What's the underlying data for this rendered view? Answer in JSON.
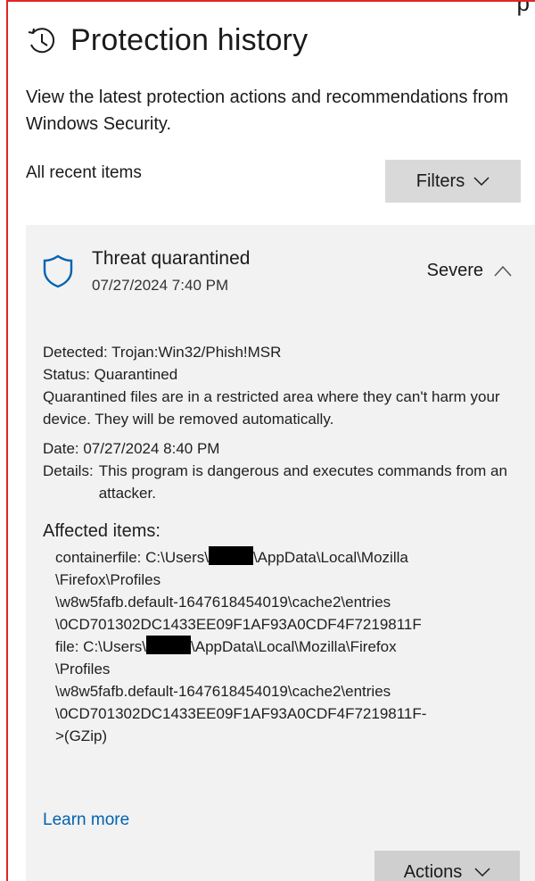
{
  "page": {
    "title": "Protection history",
    "description": "View the latest protection actions and recommendations from Windows Security.",
    "corner_text": "p"
  },
  "list": {
    "heading": "All recent items",
    "filters_label": "Filters"
  },
  "item": {
    "title": "Threat quarantined",
    "timestamp": "07/27/2024 7:40 PM",
    "severity": "Severe",
    "detected": "Detected: Trojan:Win32/Phish!MSR",
    "status": "Status: Quarantined",
    "status_note": "Quarantined files are in a restricted area where they can't harm your device. They will be removed automatically.",
    "date": "Date: 07/27/2024 8:40 PM",
    "details_label": "Details:",
    "details_text": "This program is dangerous and executes commands from an attacker.",
    "affected_title": "Affected items:",
    "affected": {
      "line1_prefix": "containerfile: C:\\Users\\",
      "line1_suffix": "\\AppData\\Local\\Mozilla",
      "line2": "\\Firefox\\Profiles",
      "line3": "\\w8w5fafb.default-1647618454019\\cache2\\entries",
      "line4": "\\0CD701302DC1433EE09F1AF93A0CDF4F7219811F",
      "line5_prefix": "file: C:\\Users\\",
      "line5_suffix": "\\AppData\\Local\\Mozilla\\Firefox",
      "line6": "\\Profiles",
      "line7": "\\w8w5fafb.default-1647618454019\\cache2\\entries",
      "line8": "\\0CD701302DC1433EE09F1AF93A0CDF4F7219811F-",
      "line9": ">(GZip)"
    },
    "learn_more": "Learn more",
    "actions_label": "Actions"
  },
  "colors": {
    "frame": "#e0262a",
    "link": "#0063b1",
    "shield": "#0063b1",
    "card": "#f2f2f2",
    "button": "#d9d9d9"
  },
  "icons": {
    "title": "history-icon",
    "threat": "shield-icon",
    "filters": "chevron-down-icon",
    "severity": "chevron-up-icon",
    "actions": "chevron-down-icon"
  }
}
